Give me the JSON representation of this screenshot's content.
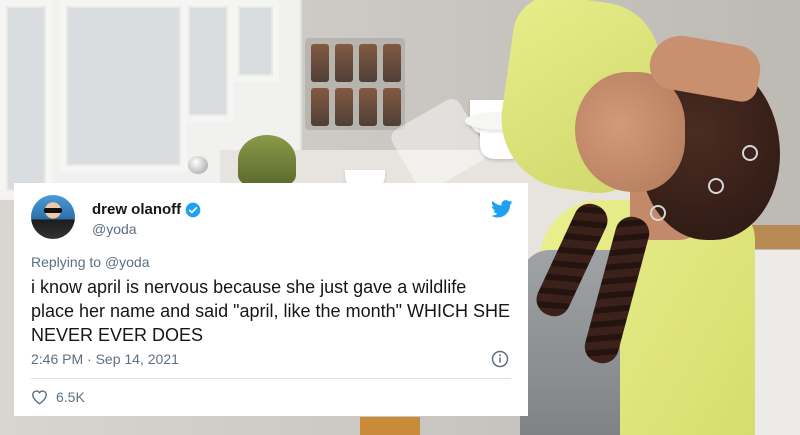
{
  "tweet": {
    "display_name": "drew olanoff",
    "handle": "@yoda",
    "replying_prefix": "Replying to",
    "replying_to": "@yoda",
    "text": "i know april is nervous because she just gave a wildlife place her name and said \"april, like the month\" WHICH SHE NEVER EVER DOES",
    "time": "2:46 PM",
    "separator": "·",
    "date": "Sep 14, 2021",
    "likes": "6.5K",
    "icons": {
      "verified": "verified-badge-icon",
      "bird": "twitter-bird-icon",
      "info": "info-icon",
      "like": "heart-icon"
    }
  },
  "colors": {
    "twitter_blue": "#1da1f2",
    "text_primary": "#14171a",
    "text_secondary": "#5b7083"
  }
}
